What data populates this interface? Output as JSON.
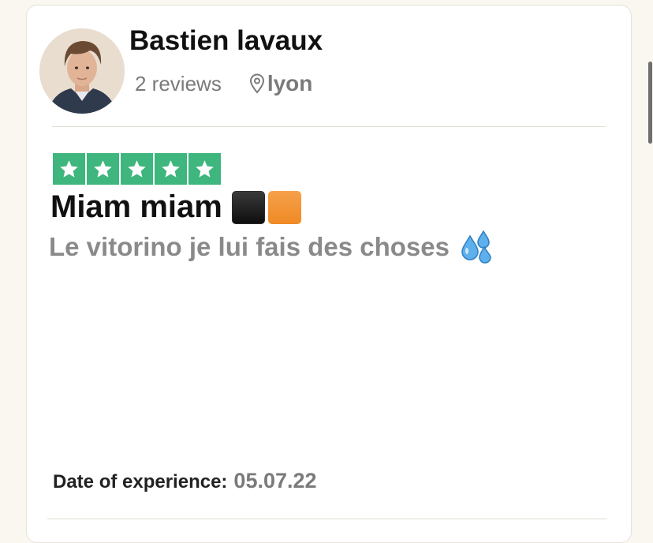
{
  "reviewer": {
    "name": "Bastien lavaux",
    "reviews_count": "2 reviews",
    "location": "lyon"
  },
  "review": {
    "rating": 5,
    "rating_max": 5,
    "title": "Miam miam",
    "body": "Le vitorino je lui fais des choses",
    "date_label": "Date of experience:",
    "date_value": "05.07.22"
  },
  "icons": {
    "avatar": "profile-photo",
    "location": "map-pin-icon",
    "star": "star-icon",
    "title_emoji_1": "black-large-square",
    "title_emoji_2": "orange-square",
    "body_emoji": "sweat-droplets-icon"
  },
  "colors": {
    "star_fill": "#3eb67d",
    "title_text": "#111111",
    "muted_text": "#8a8a8a"
  }
}
